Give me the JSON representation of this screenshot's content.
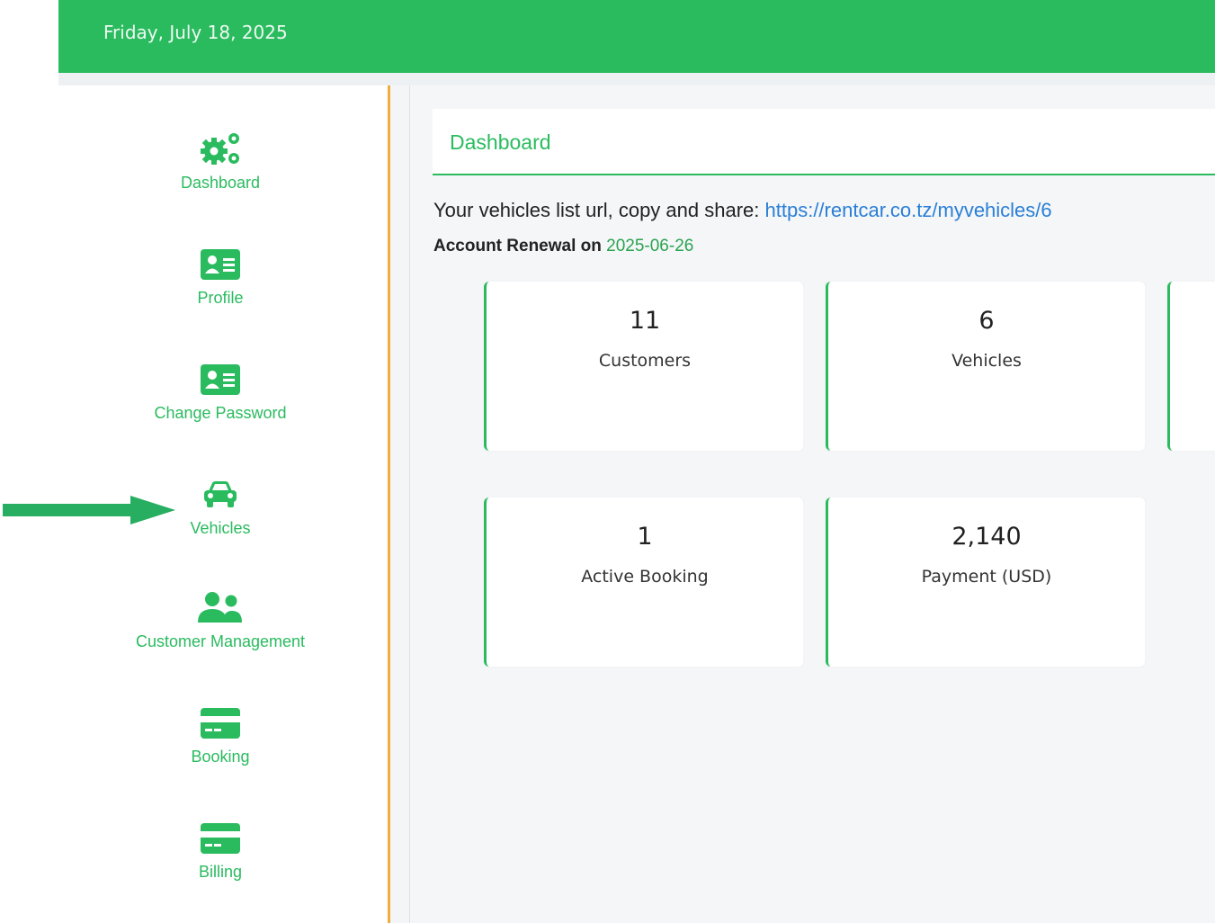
{
  "header": {
    "date": "Friday, July 18, 2025"
  },
  "sidebar": {
    "items": [
      {
        "label": "Dashboard",
        "icon": "gears-icon"
      },
      {
        "label": "Profile",
        "icon": "id-card-icon"
      },
      {
        "label": "Change Password",
        "icon": "id-card-icon"
      },
      {
        "label": "Vehicles",
        "icon": "car-icon"
      },
      {
        "label": "Customer Management",
        "icon": "users-icon"
      },
      {
        "label": "Booking",
        "icon": "credit-card-icon"
      },
      {
        "label": "Billing",
        "icon": "credit-card-icon"
      }
    ]
  },
  "main": {
    "title": "Dashboard",
    "share_text": "Your vehicles list url, copy and share:",
    "share_url": "https://rentcar.co.tz/myvehicles/6",
    "renewal_label": "Account Renewal on",
    "renewal_date": "2025-06-26",
    "stats": [
      {
        "value": "11",
        "label": "Customers"
      },
      {
        "value": "6",
        "label": "Vehicles"
      },
      {
        "value": "1",
        "label": "Active Booking"
      },
      {
        "value": "2,140",
        "label": "Payment (USD)"
      }
    ]
  },
  "colors": {
    "brand_green": "#2abb5f",
    "sidebar_divider": "#f0ad3c",
    "link_blue": "#2a7fd6"
  }
}
